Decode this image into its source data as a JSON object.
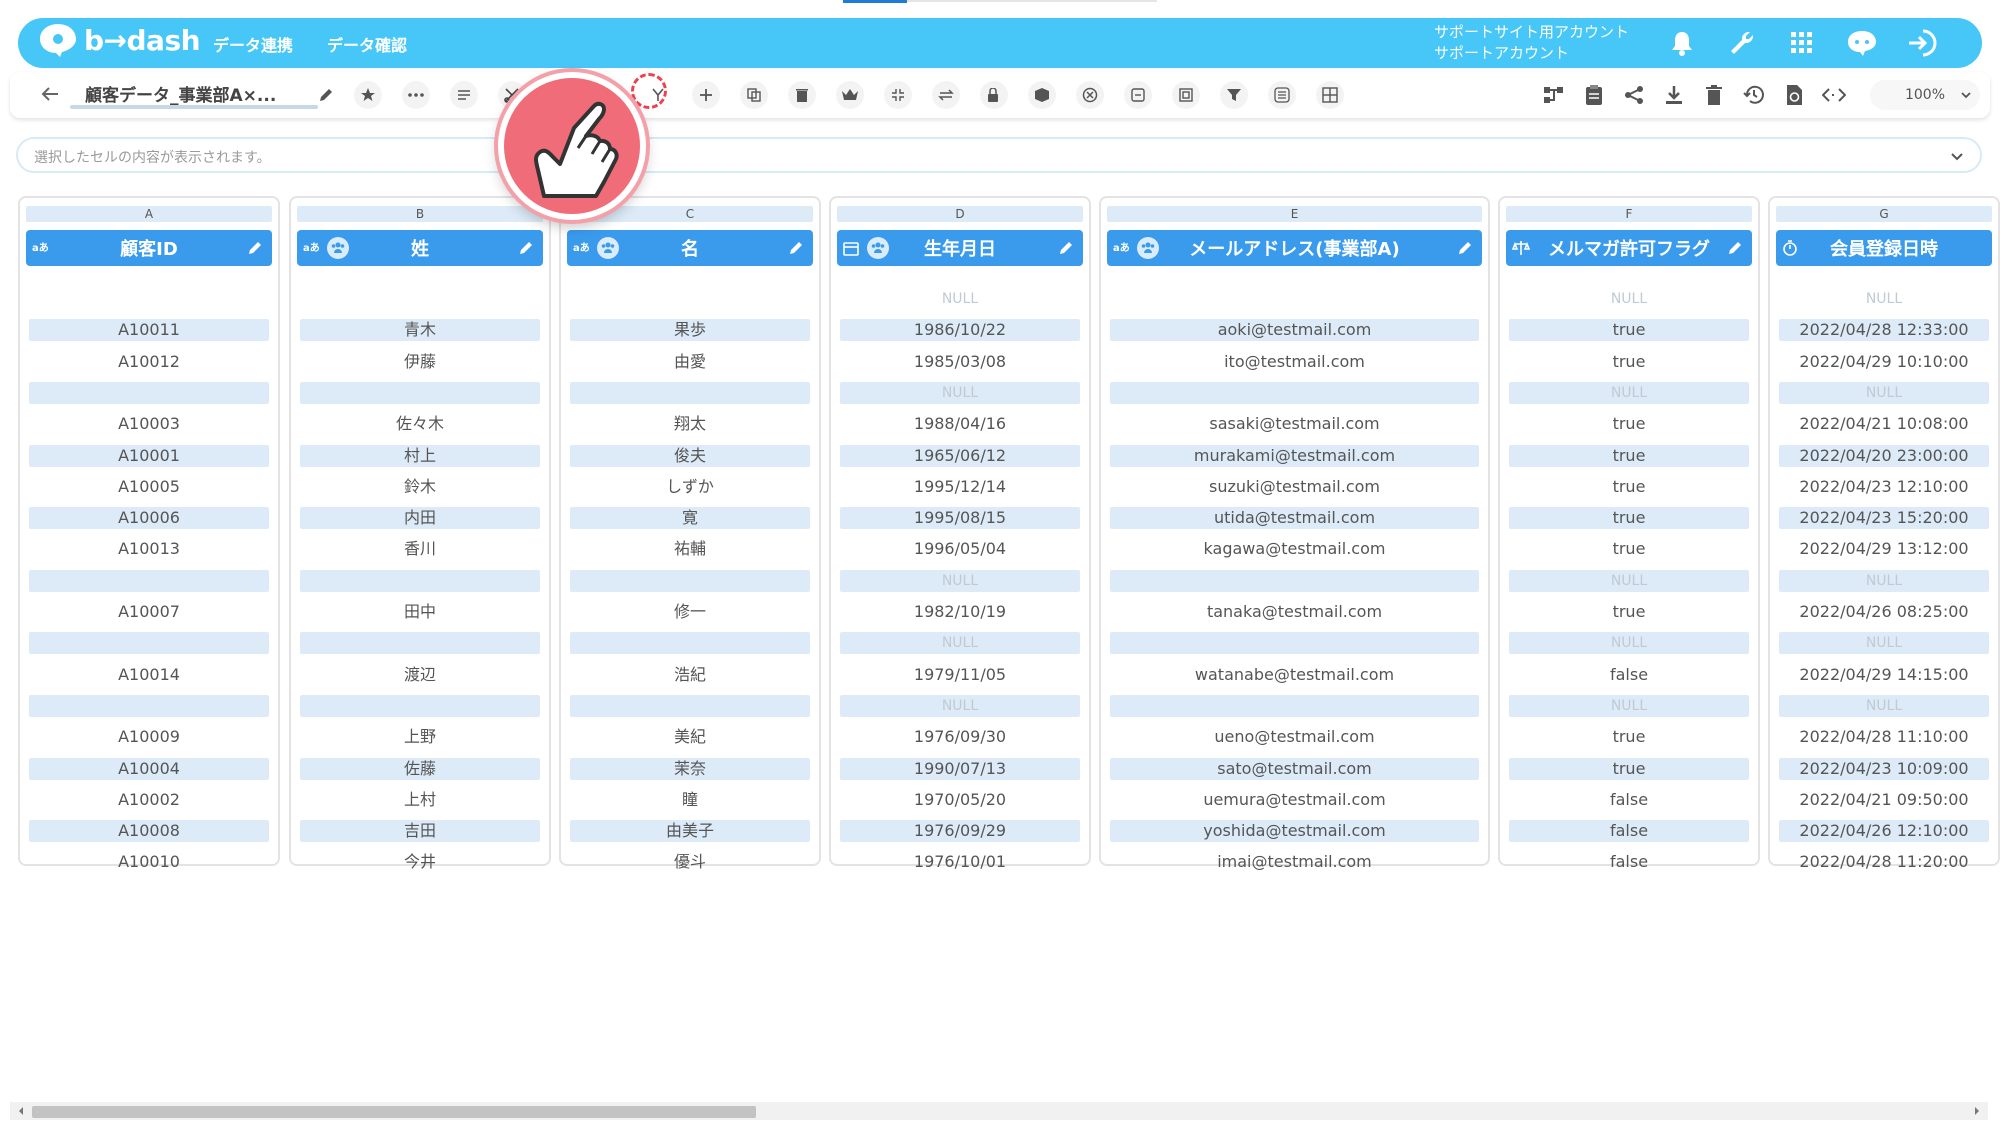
{
  "header": {
    "logo_text": "b→dash",
    "nav": [
      "データ連携",
      "データ確認"
    ],
    "account_line1": "サポートサイト用アカウント",
    "account_line2": "サポートアカウント"
  },
  "toolbar": {
    "sheet_name": "顧客データ_事業部A×...",
    "zoom": "100%"
  },
  "cellbar": {
    "placeholder": "選択したセルの内容が表示されます。"
  },
  "columns": [
    {
      "letter": "A",
      "header": "顧客ID",
      "type": "あa",
      "group": false,
      "values": [
        "",
        "A10011",
        "A10012",
        "",
        "A10003",
        "A10001",
        "A10005",
        "A10006",
        "A10013",
        "",
        "A10007",
        "",
        "A10014",
        "",
        "A10009",
        "A10004",
        "A10002",
        "A10008",
        "A10010"
      ]
    },
    {
      "letter": "B",
      "header": "姓",
      "type": "あa",
      "group": true,
      "values": [
        "",
        "青木",
        "伊藤",
        "",
        "佐々木",
        "村上",
        "鈴木",
        "内田",
        "香川",
        "",
        "田中",
        "",
        "渡辺",
        "",
        "上野",
        "佐藤",
        "上村",
        "吉田",
        "今井"
      ]
    },
    {
      "letter": "C",
      "header": "名",
      "type": "あa",
      "group": true,
      "values": [
        "",
        "果歩",
        "由愛",
        "",
        "翔太",
        "俊夫",
        "しずか",
        "寛",
        "祐輔",
        "",
        "修一",
        "",
        "浩紀",
        "",
        "美紀",
        "茉奈",
        "瞳",
        "由美子",
        "優斗"
      ]
    },
    {
      "letter": "D",
      "header": "生年月日",
      "type": "cal",
      "group": true,
      "values": [
        "NULL",
        "1986/10/22",
        "1985/03/08",
        "NULL",
        "1988/04/16",
        "1965/06/12",
        "1995/12/14",
        "1995/08/15",
        "1996/05/04",
        "NULL",
        "1982/10/19",
        "NULL",
        "1979/11/05",
        "NULL",
        "1976/09/30",
        "1990/07/13",
        "1970/05/20",
        "1976/09/29",
        "1976/10/01"
      ]
    },
    {
      "letter": "E",
      "header": "メールアドレス(事業部A)",
      "type": "あa",
      "group": true,
      "values": [
        "",
        "aoki@testmail.com",
        "ito@testmail.com",
        "",
        "sasaki@testmail.com",
        "murakami@testmail.com",
        "suzuki@testmail.com",
        "utida@testmail.com",
        "kagawa@testmail.com",
        "",
        "tanaka@testmail.com",
        "",
        "watanabe@testmail.com",
        "",
        "ueno@testmail.com",
        "sato@testmail.com",
        "uemura@testmail.com",
        "yoshida@testmail.com",
        "imai@testmail.com"
      ]
    },
    {
      "letter": "F",
      "header": "メルマガ許可フラグ",
      "type": "bal",
      "group": false,
      "values": [
        "NULL",
        "true",
        "true",
        "NULL",
        "true",
        "true",
        "true",
        "true",
        "true",
        "NULL",
        "true",
        "NULL",
        "false",
        "NULL",
        "true",
        "true",
        "false",
        "false",
        "false"
      ]
    },
    {
      "letter": "G",
      "header": "会員登録日時",
      "type": "clock",
      "group": false,
      "values": [
        "NULL",
        "2022/04/28 12:33:00",
        "2022/04/29 10:10:00",
        "NULL",
        "2022/04/21 10:08:00",
        "2022/04/20 23:00:00",
        "2022/04/23 12:10:00",
        "2022/04/23 15:20:00",
        "2022/04/29 13:12:00",
        "NULL",
        "2022/04/26 08:25:00",
        "NULL",
        "2022/04/29 14:15:00",
        "NULL",
        "2022/04/28 11:10:00",
        "2022/04/23 10:09:00",
        "2022/04/21 09:50:00",
        "2022/04/26 12:10:00",
        "2022/04/28 11:20:00"
      ]
    }
  ]
}
